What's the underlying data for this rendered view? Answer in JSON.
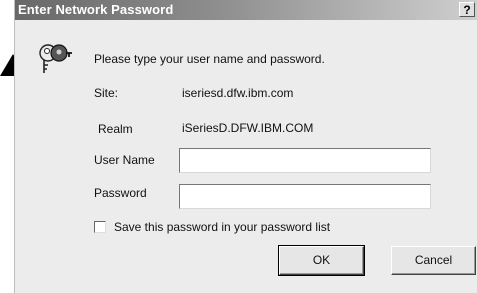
{
  "dialog": {
    "title": "Enter Network Password",
    "help_label": "?",
    "prompt": "Please type your user name and password.",
    "site_label": "Site:",
    "site_value": "iseriesd.dfw.ibm.com",
    "realm_label": "Realm",
    "realm_value": "iSeriesD.DFW.IBM.COM",
    "username_label": "User Name",
    "username_value": "",
    "password_label": "Password",
    "password_value": "",
    "save_password_label": "Save this password in your password list",
    "save_password_checked": false,
    "ok_label": "OK",
    "cancel_label": "Cancel"
  },
  "icons": {
    "dialog_icon": "keys-icon",
    "pointer": "triangle-pointer-icon"
  },
  "colors": {
    "title_bar_start": "#686868",
    "title_bar_end": "#cfcfcf",
    "dialog_background": "#ececec"
  }
}
